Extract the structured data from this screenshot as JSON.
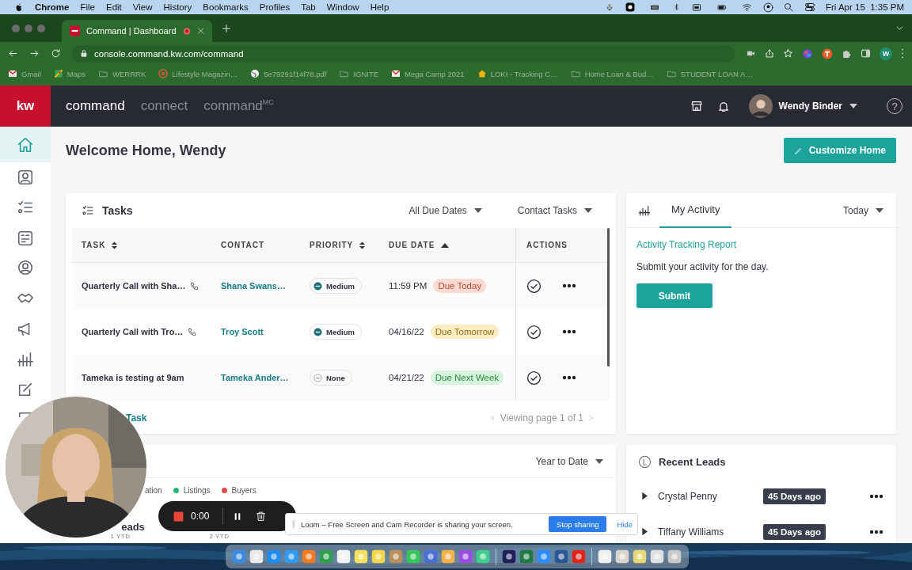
{
  "menubar": {
    "app": "Chrome",
    "menus": [
      "File",
      "Edit",
      "View",
      "History",
      "Bookmarks",
      "Profiles",
      "Tab",
      "Window",
      "Help"
    ],
    "clock": "Fri Apr 15  1:35 PM"
  },
  "browser": {
    "tab_title": "Command | Dashboard",
    "url": "console.command.kw.com/command",
    "profile": "W",
    "bookmarks": [
      {
        "label": "Gmail",
        "kind": "mail"
      },
      {
        "label": "Maps",
        "kind": "map"
      },
      {
        "label": "WERRRK",
        "kind": "folder"
      },
      {
        "label": "Lifestyle Magazin…",
        "kind": "target"
      },
      {
        "label": "5e79291f14f78.pdf",
        "kind": "globe"
      },
      {
        "label": "IGNITE",
        "kind": "folder"
      },
      {
        "label": "Mega Camp 2021",
        "kind": "mail"
      },
      {
        "label": "LOKI - Tracking C…",
        "kind": "home"
      },
      {
        "label": "Home Loan & Bud…",
        "kind": "folder"
      },
      {
        "label": "STUDENT LOAN A…",
        "kind": "folder"
      }
    ]
  },
  "header": {
    "logo": "kw",
    "nav": [
      {
        "label": "command",
        "selected": true
      },
      {
        "label": "connect",
        "selected": false
      },
      {
        "label": "command$^{MC}$",
        "selected": false
      }
    ],
    "user": "Wendy Binder",
    "help": "?"
  },
  "sidebar": {
    "items": [
      {
        "selected": true
      },
      {
        "selected": false
      },
      {
        "selected": false
      },
      {
        "selected": false
      },
      {
        "selected": false
      },
      {
        "selected": false
      },
      {
        "selected": false
      },
      {
        "selected": false
      },
      {
        "selected": false
      },
      {
        "selected": false
      }
    ]
  },
  "welcome": "Welcome Home, Wendy",
  "customize_button": "Customize Home",
  "tasks": {
    "title": "Tasks",
    "filters": [
      "All Due Dates",
      "Contact Tasks"
    ],
    "columns": [
      {
        "label": "TASK",
        "kind": "sortable"
      },
      {
        "label": "CONTACT",
        "kind": "plain"
      },
      {
        "label": "PRIORITY",
        "kind": "sortable"
      },
      {
        "label": "DUE DATE",
        "kind": "ascending"
      },
      {
        "label": "ACTIONS",
        "kind": "plain"
      }
    ],
    "rows": [
      {
        "task": "Quarterly Call with Sha…",
        "call": true,
        "contact": "Shana Swans…",
        "priority": {
          "label": "Medium",
          "kind": "medium"
        },
        "due": "11:59 PM",
        "badge": {
          "label": "Due Today",
          "kind": "today"
        }
      },
      {
        "task": "Quarterly Call with Tro…",
        "call": true,
        "contact": "Troy Scott",
        "priority": {
          "label": "Medium",
          "kind": "medium"
        },
        "due": "04/16/22",
        "badge": {
          "label": "Due Tomorrow",
          "kind": "tomorrow"
        }
      },
      {
        "task": "Tameka is testing at 9am",
        "call": false,
        "contact": "Tameka Ander…",
        "priority": {
          "label": "None",
          "kind": "none"
        },
        "due": "04/21/22",
        "badge": {
          "label": "Due Next Week",
          "kind": "week"
        }
      }
    ],
    "footer_link": "Task",
    "pagination": "Viewing page 1 of 1"
  },
  "activity": {
    "tabs": [
      {
        "label": "My Activity",
        "selected": true
      }
    ],
    "period": "Today",
    "link": "Activity Tracking Report",
    "text": "Submit your activity for the day.",
    "button": "Submit"
  },
  "stats": {
    "period": "Year to Date",
    "legend": [
      {
        "label": "ation"
      },
      {
        "label": "Listings",
        "color": "#2bb673"
      },
      {
        "label": "Buyers",
        "color": "#e5484d"
      }
    ],
    "items": [
      {
        "label": "eads",
        "sub": "1 YTD"
      },
      {
        "sub": "2 YTD"
      }
    ]
  },
  "leads": {
    "title": "Recent Leads",
    "rows": [
      {
        "name": "Crystal Penny",
        "age": "45 Days ago"
      },
      {
        "name": "Tiffany Williams",
        "age": "45 Days ago"
      }
    ]
  },
  "recorder": {
    "time": "0:00"
  },
  "share_bar": {
    "text": "Loom – Free Screen and Cam Recorder is sharing your screen.",
    "stop": "Stop sharing",
    "hide": "Hide"
  }
}
